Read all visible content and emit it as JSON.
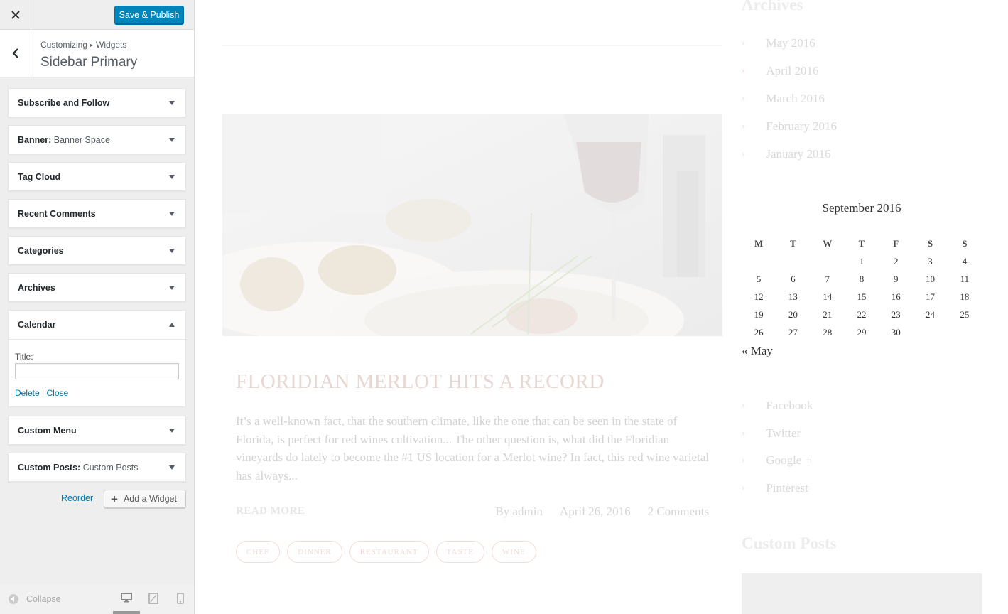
{
  "header": {
    "close_icon": "close-icon",
    "save_publish_label": "Save & Publish"
  },
  "section": {
    "breadcrumb_root": "Customizing",
    "breadcrumb_sep": "▸",
    "breadcrumb_child": "Widgets",
    "title": "Sidebar Primary"
  },
  "widgets": [
    {
      "title": "Subscribe and Follow",
      "subtitle": ""
    },
    {
      "title": "Banner:",
      "subtitle": "Banner Space"
    },
    {
      "title": "Tag Cloud",
      "subtitle": ""
    },
    {
      "title": "Recent Comments",
      "subtitle": ""
    },
    {
      "title": "Categories",
      "subtitle": ""
    },
    {
      "title": "Archives",
      "subtitle": ""
    },
    {
      "title": "Calendar",
      "subtitle": ""
    },
    {
      "title": "Custom Menu",
      "subtitle": ""
    },
    {
      "title": "Custom Posts:",
      "subtitle": "Custom Posts"
    }
  ],
  "calendar_widget": {
    "title_label": "Title:",
    "title_value": "",
    "delete_label": "Delete",
    "separator": "|",
    "close_label": "Close"
  },
  "actions": {
    "reorder_label": "Reorder",
    "add_widget_label": "Add a Widget"
  },
  "footer": {
    "collapse_label": "Collapse",
    "devices": [
      "desktop-icon",
      "tablet-icon",
      "mobile-icon"
    ],
    "active_device": "desktop"
  },
  "preview": {
    "archives_title": "Archives",
    "archives": [
      "May 2016",
      "April 2016",
      "March 2016",
      "February 2016",
      "January 2016"
    ],
    "calendar": {
      "caption": "September 2016",
      "weekdays": [
        "M",
        "T",
        "W",
        "T",
        "F",
        "S",
        "S"
      ],
      "weeks": [
        [
          "",
          "",
          "",
          "1",
          "2",
          "3",
          "4"
        ],
        [
          "5",
          "6",
          "7",
          "8",
          "9",
          "10",
          "11"
        ],
        [
          "12",
          "13",
          "14",
          "15",
          "16",
          "17",
          "18"
        ],
        [
          "19",
          "20",
          "21",
          "22",
          "23",
          "24",
          "25"
        ],
        [
          "26",
          "27",
          "28",
          "29",
          "30",
          "",
          ""
        ]
      ],
      "prev_link": "« May"
    },
    "social": [
      "Facebook",
      "Twitter",
      "Google +",
      "Pinterest"
    ],
    "custom_posts_title": "Custom Posts",
    "post": {
      "title": "FLORIDIAN MERLOT HITS A RECORD",
      "excerpt": "It’s a well-known fact, that the southern climate, like the one that can be seen in the state of Florida, is perfect for red wines cultivation... The other question is, what did the Floridian vineyards do lately to become the #1 US location for a Merlot wine? In fact, this red wine varietal has always...",
      "read_more": "READ MORE",
      "author": "By admin",
      "date": "April 26, 2016",
      "comments": "2 Comments",
      "tags": [
        "CHEF",
        "DINNER",
        "RESTAURANT",
        "TASTE",
        "WINE"
      ]
    }
  },
  "colors": {
    "primary_button": "#0085ba",
    "link": "#0073aa",
    "accent_chevron": "#f2d7d2"
  }
}
